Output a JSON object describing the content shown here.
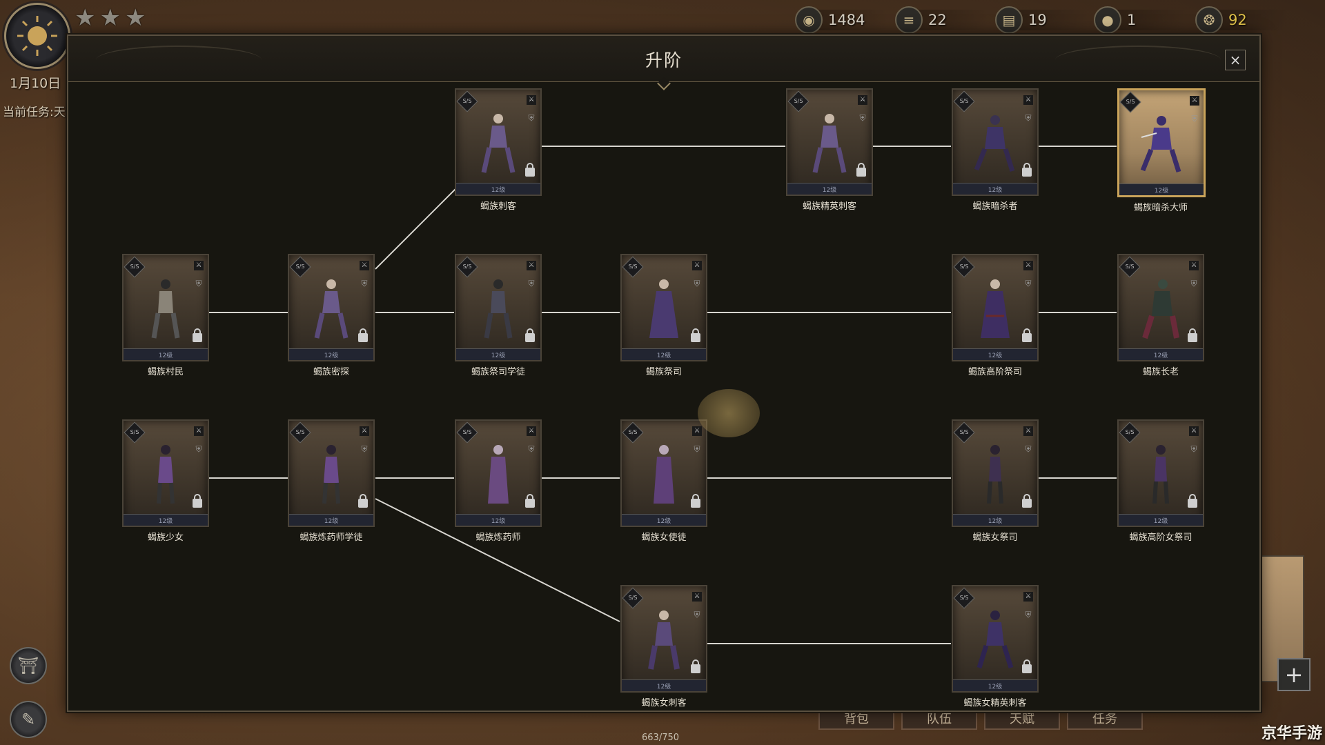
{
  "hud": {
    "stars": 3,
    "date": "1月10日",
    "current_task": "当前任务:天",
    "resources": [
      {
        "name": "coin-icon",
        "value": "1484"
      },
      {
        "name": "wood-icon",
        "value": "22"
      },
      {
        "name": "stone-icon",
        "value": "19"
      },
      {
        "name": "food-icon",
        "value": "1"
      },
      {
        "name": "horn-icon",
        "value": "92",
        "color": "#e0c24a"
      }
    ]
  },
  "modal": {
    "title": "升阶",
    "close_label": "×"
  },
  "nodes": [
    {
      "id": "assassin",
      "name": "蝎族刺客",
      "rank": "S/S",
      "level": "12级"
    },
    {
      "id": "elite-assassin",
      "name": "蝎族精英刺客",
      "rank": "S/S",
      "level": "12级"
    },
    {
      "id": "shadow-killer",
      "name": "蝎族暗杀者",
      "rank": "S/S",
      "level": "12级"
    },
    {
      "id": "shadow-master",
      "name": "蝎族暗杀大师",
      "rank": "S/S",
      "level": "12级",
      "unlocked": true
    },
    {
      "id": "villager",
      "name": "蝎族村民",
      "rank": "S/S",
      "level": "12级"
    },
    {
      "id": "scout",
      "name": "蝎族密探",
      "rank": "S/S",
      "level": "12级"
    },
    {
      "id": "priest-apprentice",
      "name": "蝎族祭司学徒",
      "rank": "S/S",
      "level": "12级"
    },
    {
      "id": "priest",
      "name": "蝎族祭司",
      "rank": "S/S",
      "level": "12级"
    },
    {
      "id": "high-priest",
      "name": "蝎族高阶祭司",
      "rank": "S/S",
      "level": "12级"
    },
    {
      "id": "elder",
      "name": "蝎族长老",
      "rank": "S/S",
      "level": "12级"
    },
    {
      "id": "girl",
      "name": "蝎族少女",
      "rank": "S/S",
      "level": "12级"
    },
    {
      "id": "alchemist-apprentice",
      "name": "蝎族炼药师学徒",
      "rank": "S/S",
      "level": "12级"
    },
    {
      "id": "alchemist",
      "name": "蝎族炼药师",
      "rank": "S/S",
      "level": "12级"
    },
    {
      "id": "female-envoy",
      "name": "蝎族女使徒",
      "rank": "S/S",
      "level": "12级"
    },
    {
      "id": "priestess",
      "name": "蝎族女祭司",
      "rank": "S/S",
      "level": "12级"
    },
    {
      "id": "high-priestess",
      "name": "蝎族高阶女祭司",
      "rank": "S/S",
      "level": "12级"
    },
    {
      "id": "female-assassin",
      "name": "蝎族女刺客",
      "rank": "S/S",
      "level": "12级"
    },
    {
      "id": "female-elite-assassin",
      "name": "蝎族女精英刺客",
      "rank": "S/S",
      "level": "12级"
    }
  ],
  "bottom_tabs": [
    "背包",
    "队伍",
    "天赋",
    "任务"
  ],
  "exp_text": "663/750",
  "watermark": "京华手游"
}
